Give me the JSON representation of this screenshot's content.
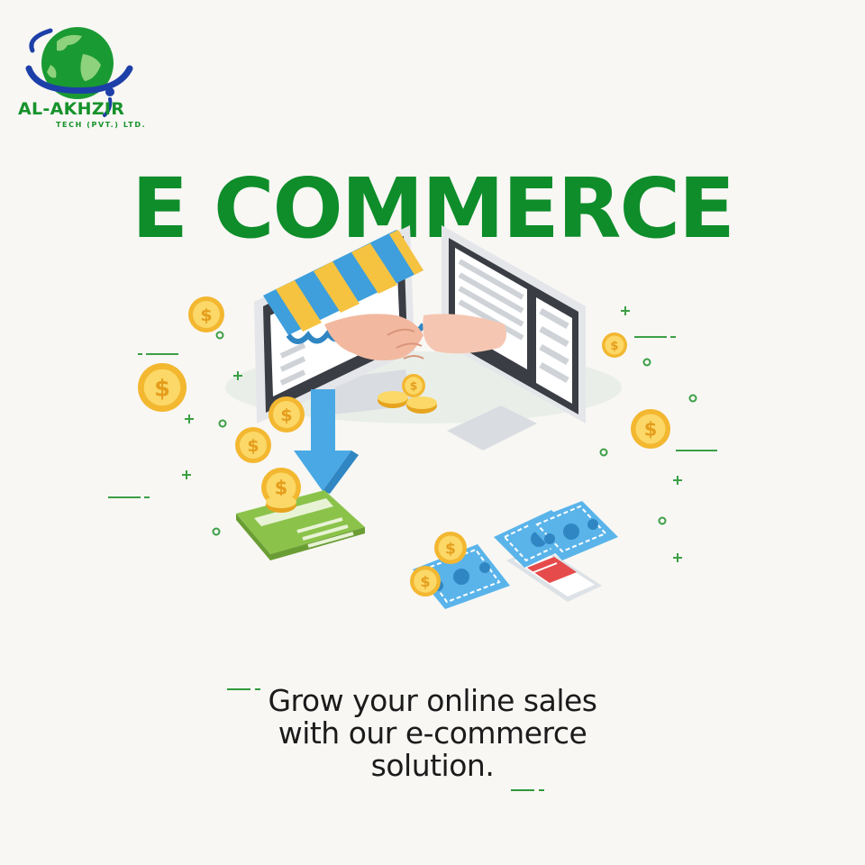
{
  "brand": {
    "name": "AL-AKHZIR",
    "subtitle": "TECH (PVT.) LTD."
  },
  "headline": "E COMMERCE",
  "tagline": {
    "line1": "Grow your online sales",
    "line2": "with our e-commerce",
    "line3": "solution."
  },
  "icons": {
    "coin": "dollar-coin-icon",
    "banknote": "banknote-icon",
    "card": "credit-card-icon"
  },
  "colors": {
    "background": "#f8f7f4",
    "brand_green": "#0e8d2a",
    "coin_gold": "#f6c341",
    "awning_blue": "#3e9fdc",
    "awning_yellow": "#f6c341",
    "screen_dark": "#3a3d44"
  }
}
